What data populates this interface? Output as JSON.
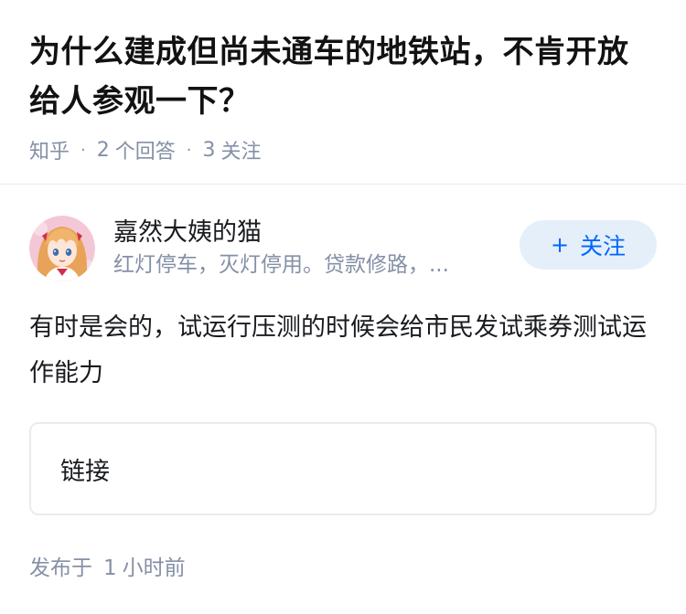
{
  "question": {
    "title": "为什么建成但尚未通车的地铁站，不肯开放给人参观一下？",
    "source": "知乎",
    "answer_count": "2",
    "answer_label": "个回答",
    "follower_count": "3",
    "follower_label": "关注"
  },
  "answer": {
    "author_name": "嘉然大姨的猫",
    "author_bio": "红灯停车，灭灯停用。贷款修路，...",
    "follow_label": "关注",
    "follow_icon": "plus-icon",
    "content": "有时是会的，试运行压测的时候会给市民发试乘券测试运作能力",
    "link_label": "链接",
    "publish_prefix": "发布于",
    "publish_num": "1",
    "publish_suffix": "小时前"
  },
  "colors": {
    "accent": "#0066ff",
    "follow_bg": "#e5effa",
    "meta": "#8590a6"
  }
}
